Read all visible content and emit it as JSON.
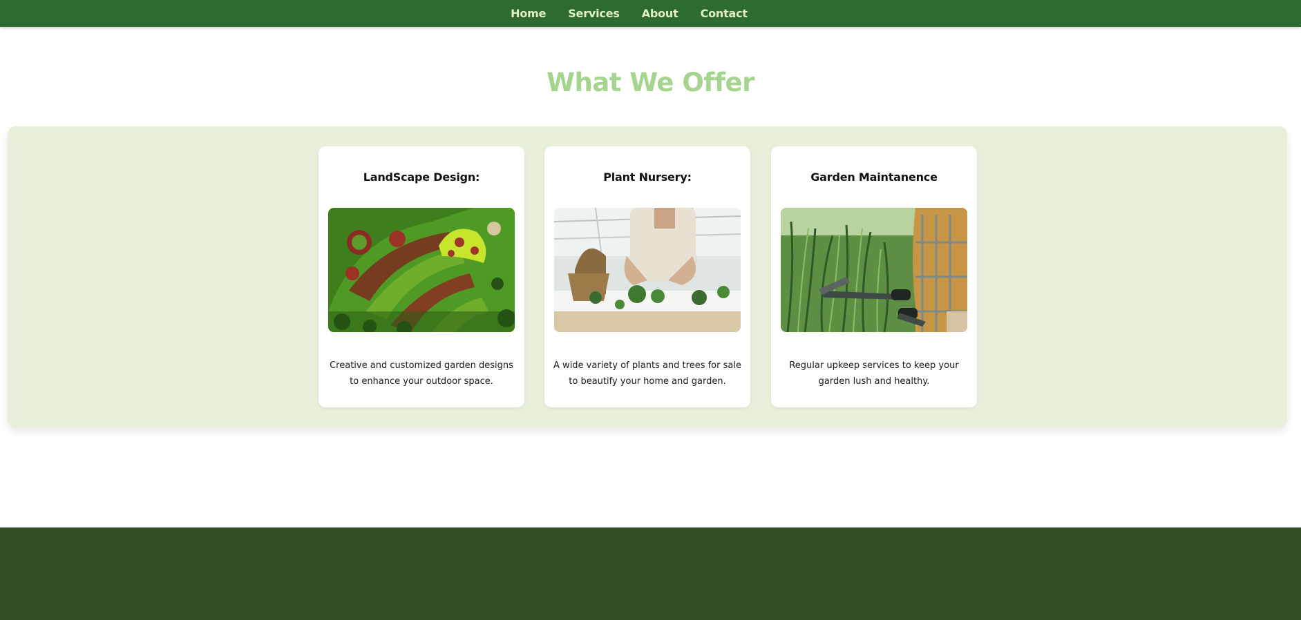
{
  "nav": {
    "items": [
      {
        "label": "Home"
      },
      {
        "label": "Services"
      },
      {
        "label": "About"
      },
      {
        "label": "Contact"
      }
    ]
  },
  "section": {
    "title": "What We Offer"
  },
  "cards": [
    {
      "title": "LandScape Design:",
      "image": "aerial-garden-design-photo",
      "description": "Creative and customized garden designs to enhance your outdoor space."
    },
    {
      "title": "Plant Nursery:",
      "image": "greenhouse-planting-photo",
      "description": "A wide variety of plants and trees for sale to beautify your home and garden."
    },
    {
      "title": "Garden Maintanence",
      "image": "hedge-trimming-photo",
      "description": "Regular upkeep services to keep your garden lush and healthy."
    }
  ],
  "colors": {
    "nav_bg": "#2e6b30",
    "nav_text": "#e2f1c4",
    "title": "#a5d48e",
    "panel_bg": "#e8f0dc",
    "footer_bg": "#344e25"
  }
}
